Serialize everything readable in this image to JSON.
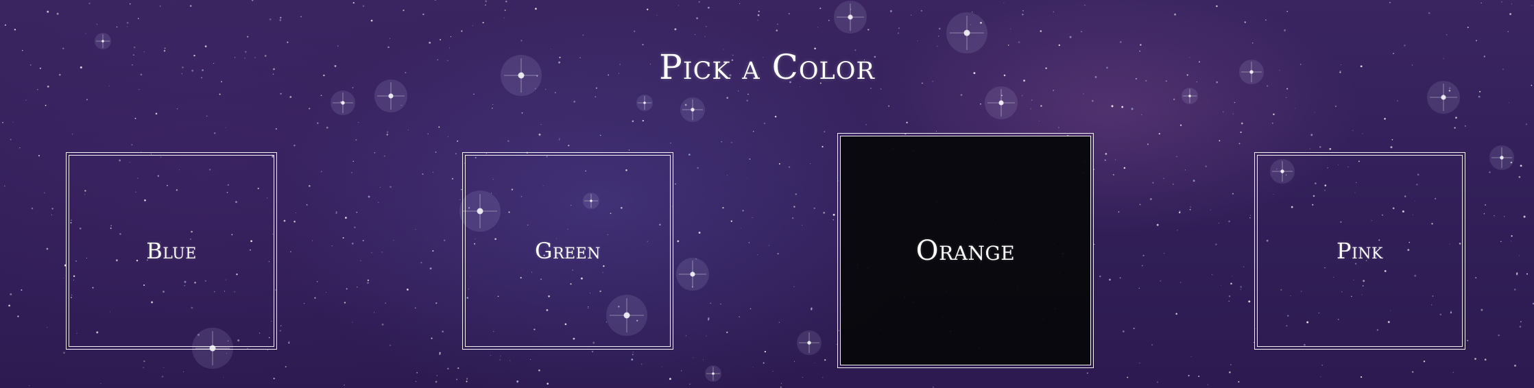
{
  "page": {
    "title": "Pick a Color"
  },
  "cards": [
    {
      "label": "Blue",
      "selected": false
    },
    {
      "label": "Green",
      "selected": false
    },
    {
      "label": "Orange",
      "selected": true
    },
    {
      "label": "Pink",
      "selected": false
    }
  ],
  "colors": {
    "background": "#33205a",
    "border": "#ffffff",
    "selected_fill": "#08080c",
    "text": "#ffffff"
  }
}
